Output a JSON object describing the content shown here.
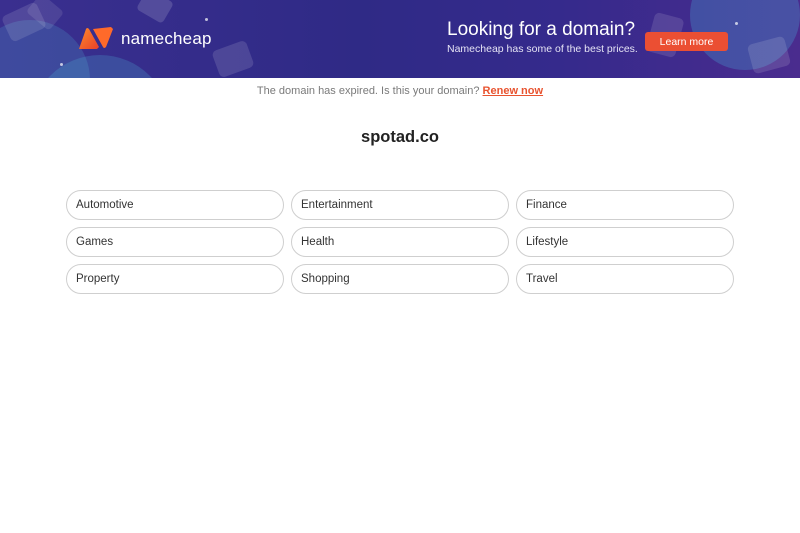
{
  "banner": {
    "logo_text": "namecheap",
    "promo_title": "Looking for a domain?",
    "promo_subtitle": "Namecheap has some of the best prices.",
    "learn_more_label": "Learn more",
    "accent_color": "#eb4f33",
    "background_color": "#2f2a86"
  },
  "notice": {
    "text": "The domain has expired. Is this your domain?",
    "renew_label": "Renew now"
  },
  "domain_name": "spotad.co",
  "categories": [
    "Automotive",
    "Entertainment",
    "Finance",
    "Games",
    "Health",
    "Lifestyle",
    "Property",
    "Shopping",
    "Travel"
  ]
}
